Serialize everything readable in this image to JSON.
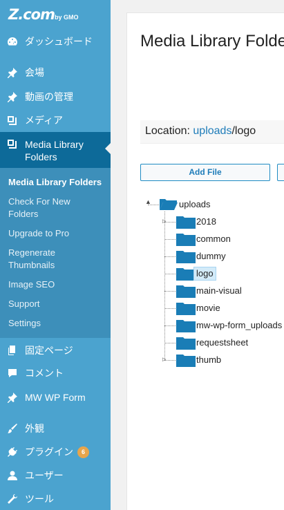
{
  "brand": {
    "logo_text": "Z.com",
    "logo_sub": "by GMO"
  },
  "sidebar": {
    "items": [
      {
        "label": "ダッシュボード",
        "icon": "dashboard-icon"
      },
      {
        "label": "会場",
        "icon": "pin-icon"
      },
      {
        "label": "動画の管理",
        "icon": "pin-icon"
      },
      {
        "label": "メディア",
        "icon": "media-icon"
      },
      {
        "label": "Media Library Folders",
        "icon": "media-icon"
      },
      {
        "label": "固定ページ",
        "icon": "pages-icon"
      },
      {
        "label": "コメント",
        "icon": "comments-icon"
      },
      {
        "label": "MW WP Form",
        "icon": "pin-icon"
      },
      {
        "label": "外観",
        "icon": "appearance-icon"
      },
      {
        "label": "プラグイン",
        "icon": "plugins-icon",
        "badge": "6"
      },
      {
        "label": "ユーザー",
        "icon": "users-icon"
      },
      {
        "label": "ツール",
        "icon": "tools-icon"
      }
    ],
    "submenu": [
      {
        "label": "Media Library Folders"
      },
      {
        "label": "Check For New Folders"
      },
      {
        "label": "Upgrade to Pro"
      },
      {
        "label": "Regenerate Thumbnails"
      },
      {
        "label": "Image SEO"
      },
      {
        "label": "Support"
      },
      {
        "label": "Settings"
      }
    ]
  },
  "main": {
    "title": "Media Library Folders",
    "location_label": "Location:",
    "location_root": "uploads",
    "location_sep": "/",
    "location_current": "logo",
    "add_file_label": "Add File"
  },
  "tree": {
    "root": "uploads",
    "children": [
      "2018",
      "common",
      "dummy",
      "logo",
      "main-visual",
      "movie",
      "mw-wp-form_uploads",
      "requestsheet",
      "thumb"
    ],
    "selected": "logo"
  },
  "colors": {
    "sidebar": "#4ba3cf",
    "sidebar_active": "#0d6a99",
    "submenu": "#3d8fba",
    "folder": "#1a7db6",
    "link": "#1e7cb9"
  }
}
